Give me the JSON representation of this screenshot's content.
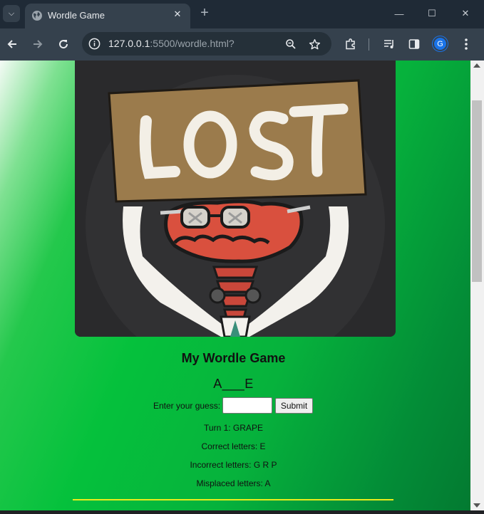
{
  "browser": {
    "tab_title": "Wordle Game",
    "url_host": "127.0.0.1",
    "url_rest": ":5500/wordle.html?",
    "profile_initial": "G"
  },
  "page": {
    "image_text": "LOST",
    "title": "My Wordle Game",
    "word_display": "A___E",
    "guess_label": "Enter your guess:",
    "guess_value": "",
    "submit_label": "Submit",
    "turn_text": "Turn 1: GRAPE",
    "correct_text": "Correct letters: E",
    "incorrect_text": "Incorrect letters: G R P",
    "misplaced_text": "Misplaced letters: A"
  },
  "colors": {
    "chrome_dark": "#1f2a36",
    "chrome_toolbar": "#35414d",
    "page_green": "#05c13c",
    "divider_yellow": "#e8ed1a",
    "sign_brown": "#9b7b4c",
    "character_red": "#d9503e"
  }
}
